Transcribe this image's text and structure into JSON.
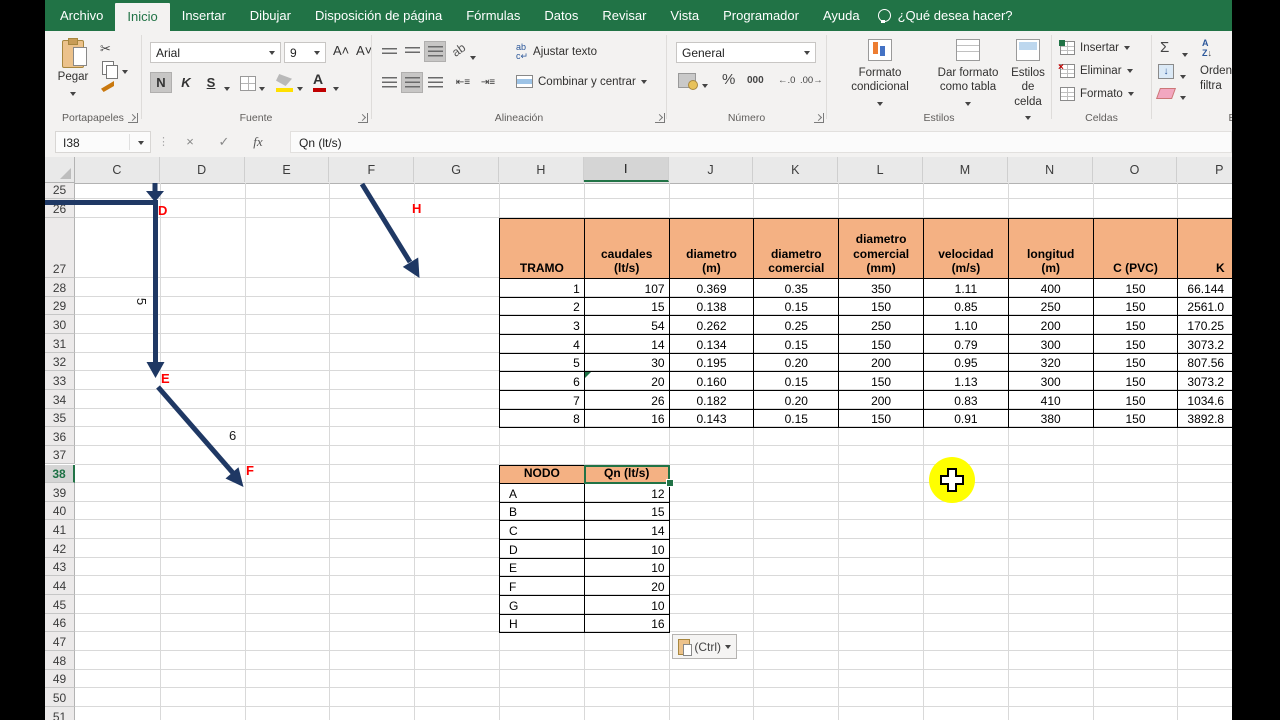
{
  "tabs": {
    "items": [
      {
        "label": "Archivo",
        "active": false
      },
      {
        "label": "Inicio",
        "active": true
      },
      {
        "label": "Insertar",
        "active": false
      },
      {
        "label": "Dibujar",
        "active": false
      },
      {
        "label": "Disposición de página",
        "active": false
      },
      {
        "label": "Fórmulas",
        "active": false
      },
      {
        "label": "Datos",
        "active": false
      },
      {
        "label": "Revisar",
        "active": false
      },
      {
        "label": "Vista",
        "active": false
      },
      {
        "label": "Programador",
        "active": false
      },
      {
        "label": "Ayuda",
        "active": false
      }
    ],
    "search_hint": "¿Qué desea hacer?"
  },
  "ribbon": {
    "clipboard": {
      "paste": "Pegar",
      "group": "Portapapeles"
    },
    "font": {
      "family": "Arial",
      "size": "9",
      "bold": "N",
      "italic": "K",
      "underline": "S",
      "group": "Fuente"
    },
    "alignment": {
      "wrap": "Ajustar texto",
      "merge": "Combinar y centrar",
      "group": "Alineación"
    },
    "number": {
      "format": "General",
      "percent": "%",
      "thousands": "000",
      "inc_dec": "←.0",
      "dec_dec": ".00→",
      "group": "Número"
    },
    "styles": {
      "conditional": "Formato condicional",
      "as_table": "Dar formato como tabla",
      "cell_styles": "Estilos de celda",
      "group": "Estilos"
    },
    "cells": {
      "insert": "Insertar",
      "del": "Eliminar",
      "format": "Formato",
      "group": "Celdas"
    },
    "editing": {
      "sum": "Σ",
      "sort_line1": "Orden",
      "sort_line2": "filtra",
      "group": "E"
    }
  },
  "formula_bar": {
    "name_box": "I38",
    "cancel": "×",
    "enter": "✓",
    "fx": "fx",
    "content": "Qn (lt/s)"
  },
  "sheet": {
    "columns": [
      "C",
      "D",
      "E",
      "F",
      "G",
      "H",
      "I",
      "J",
      "K",
      "L",
      "M",
      "N",
      "O",
      "P"
    ],
    "selected_column": "I",
    "rows": [
      "25",
      "26",
      "27",
      "28",
      "29",
      "30",
      "31",
      "32",
      "33",
      "34",
      "35",
      "36",
      "37",
      "38",
      "39",
      "40",
      "41",
      "42",
      "43",
      "44",
      "45",
      "46",
      "47",
      "48",
      "49",
      "50",
      "51"
    ],
    "selected_row": "38"
  },
  "pipe_table": {
    "headers": [
      "TRAMO",
      "caudales\n(lt/s)",
      "diametro\n(m)",
      "diametro\ncomercial",
      "diametro\ncomercial\n(mm)",
      "velocidad\n(m/s)",
      "longitud\n(m)",
      "C (PVC)",
      "K"
    ],
    "rows": [
      [
        "1",
        "107",
        "0.369",
        "0.35",
        "350",
        "1.11",
        "400",
        "150",
        "66.144"
      ],
      [
        "2",
        "15",
        "0.138",
        "0.15",
        "150",
        "0.85",
        "250",
        "150",
        "2561.0"
      ],
      [
        "3",
        "54",
        "0.262",
        "0.25",
        "250",
        "1.10",
        "200",
        "150",
        "170.25"
      ],
      [
        "4",
        "14",
        "0.134",
        "0.15",
        "150",
        "0.79",
        "300",
        "150",
        "3073.2"
      ],
      [
        "5",
        "30",
        "0.195",
        "0.20",
        "200",
        "0.95",
        "320",
        "150",
        "807.56"
      ],
      [
        "6",
        "20",
        "0.160",
        "0.15",
        "150",
        "1.13",
        "300",
        "150",
        "3073.2"
      ],
      [
        "7",
        "26",
        "0.182",
        "0.20",
        "200",
        "0.83",
        "410",
        "150",
        "1034.6"
      ],
      [
        "8",
        "16",
        "0.143",
        "0.15",
        "150",
        "0.91",
        "380",
        "150",
        "3892.8"
      ]
    ]
  },
  "node_table": {
    "headers": [
      "NODO",
      "Qn (lt/s)"
    ],
    "rows": [
      [
        "A",
        "12"
      ],
      [
        "B",
        "15"
      ],
      [
        "C",
        "14"
      ],
      [
        "D",
        "10"
      ],
      [
        "E",
        "10"
      ],
      [
        "F",
        "20"
      ],
      [
        "G",
        "10"
      ],
      [
        "H",
        "16"
      ]
    ]
  },
  "diagram": {
    "labels": [
      {
        "text": "D",
        "color": "#FF0000"
      },
      {
        "text": "E",
        "color": "#FF0000"
      },
      {
        "text": "F",
        "color": "#FF0000"
      },
      {
        "text": "H",
        "color": "#FF0000"
      },
      {
        "text": "5",
        "color": "#1a1a1a"
      },
      {
        "text": "6",
        "color": "#1a1a1a"
      }
    ]
  },
  "paste_options": {
    "label": "(Ctrl)"
  },
  "colors": {
    "accent": "#217346",
    "table_header_fill": "#F4B183",
    "arrow": "#1F3864",
    "highlight": "#FFFF00",
    "label_red": "#FF0000"
  }
}
